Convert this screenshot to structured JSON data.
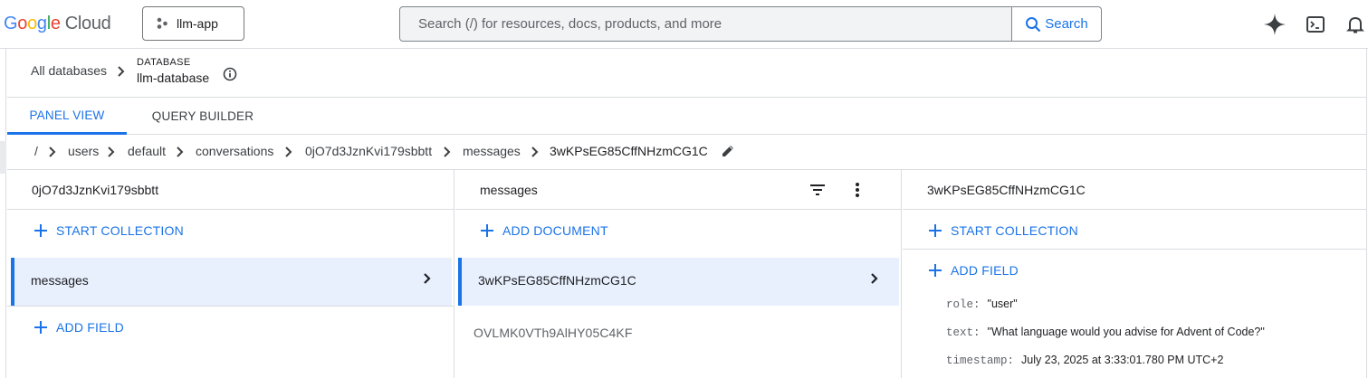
{
  "topbar": {
    "logo_google": "Google",
    "logo_cloud": "Cloud",
    "project_name": "llm-app",
    "search_placeholder": "Search (/) for resources, docs, products, and more",
    "search_button": "Search",
    "icons": [
      "gemini-spark-icon",
      "cloud-shell-icon",
      "notifications-icon"
    ]
  },
  "db_header": {
    "all_databases": "All databases",
    "database_label": "DATABASE",
    "database_name": "llm-database"
  },
  "tabs": [
    {
      "label": "PANEL VIEW",
      "active": true
    },
    {
      "label": "QUERY BUILDER",
      "active": false
    }
  ],
  "path": [
    "/",
    "users",
    "default",
    "conversations",
    "0jO7d3JznKvi179sbbtt",
    "messages",
    "3wKPsEG85CffNHzmCG1C"
  ],
  "panels": {
    "conversation": {
      "title": "0jO7d3JznKvi179sbbtt",
      "start_collection": "START COLLECTION",
      "collections": [
        "messages"
      ],
      "add_field": "ADD FIELD"
    },
    "messages": {
      "title": "messages",
      "add_document": "ADD DOCUMENT",
      "documents": [
        "3wKPsEG85CffNHzmCG1C",
        "OVLMK0VTh9AlHY05C4KF"
      ]
    },
    "document": {
      "title": "3wKPsEG85CffNHzmCG1C",
      "start_collection": "START COLLECTION",
      "add_field": "ADD FIELD",
      "fields": [
        {
          "key": "role:",
          "value": "\"user\""
        },
        {
          "key": "text:",
          "value": "\"What language would you advise for Advent of Code?\""
        },
        {
          "key": "timestamp:",
          "value": "July 23, 2025 at 3:33:01.780 PM UTC+2"
        }
      ]
    }
  },
  "colors": {
    "accent": "#1a73e8",
    "selected_row": "#e8f0fe",
    "border": "#dadce0"
  }
}
